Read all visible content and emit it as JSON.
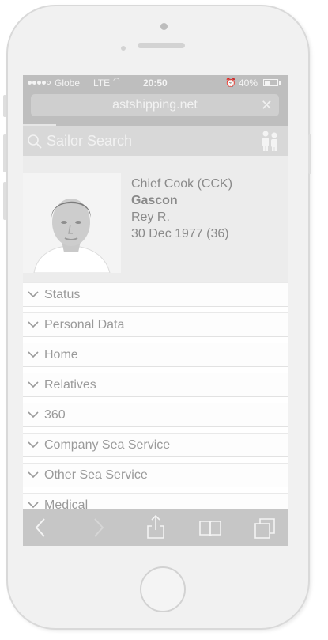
{
  "status_bar": {
    "carrier": "Globe",
    "network": "LTE",
    "time": "20:50",
    "battery": "40%",
    "battery_level": 0.4
  },
  "browser": {
    "url": "astshipping.net",
    "close_symbol": "✕"
  },
  "search": {
    "placeholder": "Sailor Search",
    "icon": "search-icon",
    "people_icon": "people-icon"
  },
  "profile": {
    "rank": "Chief Cook (CCK)",
    "surname": "Gascon",
    "given_name": "Rey R.",
    "birth": "30 Dec 1977 (36)"
  },
  "sections": [
    {
      "label": "Status"
    },
    {
      "label": "Personal Data"
    },
    {
      "label": "Home"
    },
    {
      "label": "Relatives"
    },
    {
      "label": "360"
    },
    {
      "label": "Company Sea Service"
    },
    {
      "label": "Other Sea Service"
    },
    {
      "label": "Medical"
    }
  ],
  "toolbar": {
    "icons": [
      "back-icon",
      "forward-icon",
      "share-icon",
      "bookmarks-icon",
      "tabs-icon"
    ]
  },
  "colors": {
    "bar_gray": "#bebebe",
    "search_gray": "#d8d8d8",
    "text_gray": "#9a9a9a"
  }
}
